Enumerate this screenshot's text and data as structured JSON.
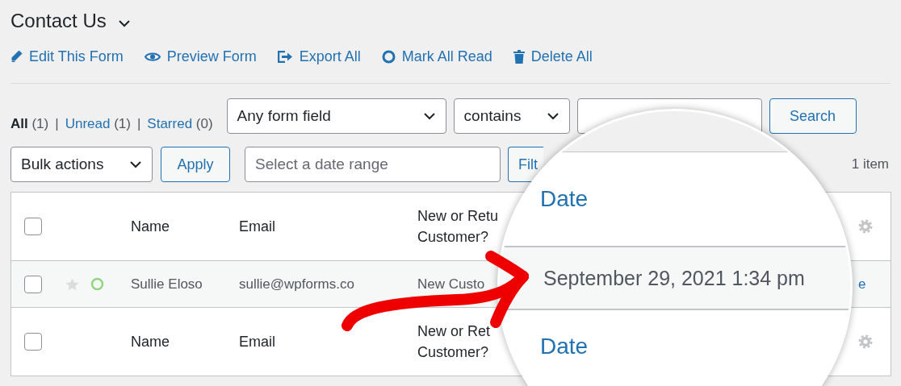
{
  "title": "Contact Us",
  "actions": [
    {
      "kind": "pencil",
      "label": "Edit This Form"
    },
    {
      "kind": "eye",
      "label": "Preview Form"
    },
    {
      "kind": "export",
      "label": "Export All"
    },
    {
      "kind": "ring",
      "label": "Mark All Read"
    },
    {
      "kind": "trash",
      "label": "Delete All"
    }
  ],
  "views": [
    {
      "label": "All",
      "count": "(1)",
      "selected": true
    },
    {
      "separator": "|",
      "label": "Unread",
      "count": "(1)",
      "selected": false
    },
    {
      "separator": "|",
      "label": "Starred",
      "count": "(0)",
      "selected": false
    }
  ],
  "search": {
    "field": "Any form field",
    "operator": "contains",
    "button": "Search"
  },
  "bulk": {
    "select": "Bulk actions",
    "apply": "Apply",
    "date_placeholder": "Select a date range",
    "filter": "Filt",
    "count": "1 item"
  },
  "table": {
    "header": {
      "checked": false,
      "name": "Name",
      "email": "Email",
      "question": [
        "New or Retu",
        "Customer?"
      ]
    },
    "rows": [
      {
        "checked": false,
        "starred": false,
        "name": "Sullie Eloso",
        "email": "sullie@wpforms.co",
        "answer": "New Custo",
        "action": "e"
      }
    ],
    "footer": {
      "checked": false,
      "name": "Name",
      "email": "Email",
      "question": [
        "New or Ret",
        "Customer?"
      ]
    }
  },
  "magnifier": {
    "header": "Date",
    "value": "September 29, 2021 1:34 pm",
    "footer": "Date"
  }
}
